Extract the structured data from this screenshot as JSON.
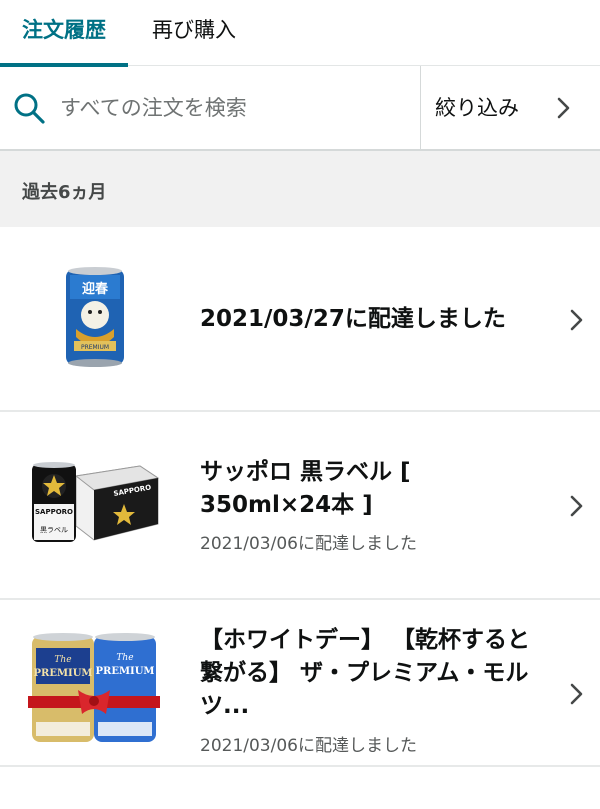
{
  "tabs": [
    {
      "label": "注文履歴",
      "active": true
    },
    {
      "label": "再び購入",
      "active": false
    }
  ],
  "search": {
    "placeholder": "すべての注文を検索",
    "icon": "search-icon"
  },
  "filter": {
    "label": "絞り込み",
    "icon": "chevron-right-icon"
  },
  "section": {
    "title": "過去6ヵ月"
  },
  "orders": [
    {
      "title": "2021/03/27に配達しました",
      "status": "",
      "image": "beer-can-image"
    },
    {
      "title_line1": "サッポロ 黒ラベル [",
      "title_line2": "350ml×24本 ]",
      "status": "2021/03/06に配達しました",
      "image": "sapporo-black-label-image"
    },
    {
      "title_line1": "【ホワイトデー】 【乾杯すると",
      "title_line2": "繋がる】 ザ・プレミアム・モル",
      "title_line3": "ツ...",
      "status": "2021/03/06に配達しました",
      "image": "premium-malts-image"
    }
  ],
  "colors": {
    "accent": "#007185",
    "section_bg": "#f1f1f1",
    "text_secondary": "#565959"
  }
}
